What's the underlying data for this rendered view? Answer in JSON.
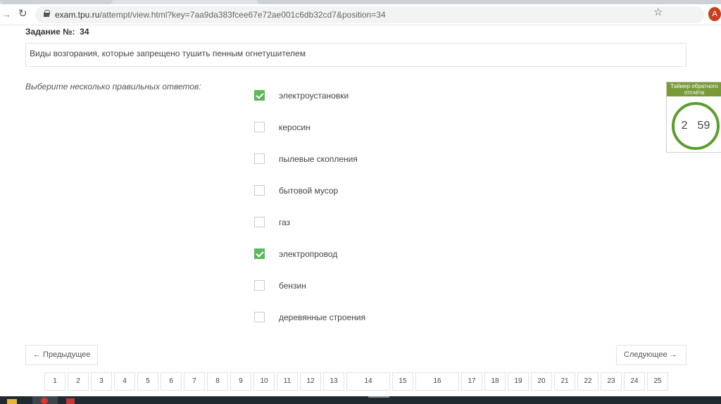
{
  "browser": {
    "url_host": "exam.tpu.ru",
    "url_path": "/attempt/view.html?key=7aa9da383fcee67e72ae001c6db32cd7&position=34",
    "avatar_letter": "A"
  },
  "question": {
    "label": "Задание №:",
    "number": "34",
    "text": "Виды возгорания, которые запрещено тушить пенным огнетушителем",
    "instruction": "Выберите несколько правильных ответов:"
  },
  "options": [
    {
      "label": "электроустановки",
      "checked": true
    },
    {
      "label": "керосин",
      "checked": false
    },
    {
      "label": "пылевые скопления",
      "checked": false
    },
    {
      "label": "бытовой мусор",
      "checked": false
    },
    {
      "label": "газ",
      "checked": false
    },
    {
      "label": "электропровод",
      "checked": true
    },
    {
      "label": "бензин",
      "checked": false
    },
    {
      "label": "деревянные строения",
      "checked": false
    }
  ],
  "timer": {
    "title": "Таймер обратного отсчёта",
    "minutes": "2",
    "seconds": "59",
    "color": "#5a9e2c"
  },
  "nav": {
    "prev": "← Предыдущее",
    "next": "Следующее →"
  },
  "pages": [
    "1",
    "2",
    "3",
    "4",
    "5",
    "6",
    "7",
    "8",
    "9",
    "10",
    "11",
    "12",
    "13",
    "14",
    "15",
    "16",
    "17",
    "18",
    "19",
    "20",
    "21",
    "22",
    "23",
    "24",
    "25"
  ]
}
